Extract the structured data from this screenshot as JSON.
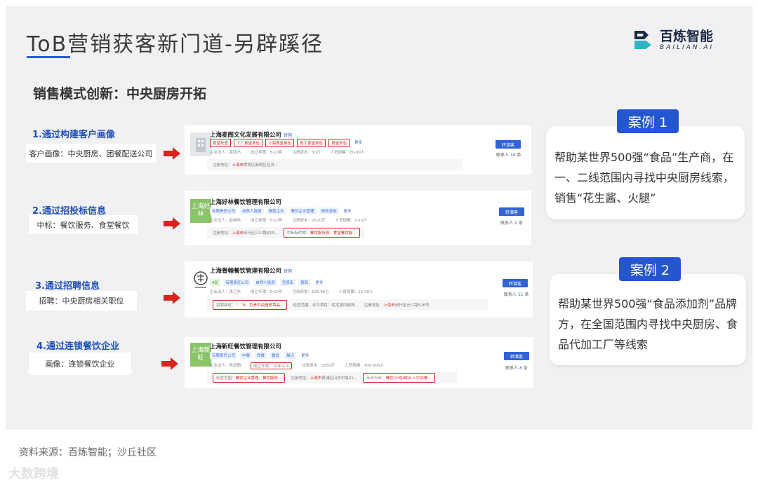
{
  "header": {
    "title": "ToB营销获客新门道-另辟蹊径",
    "subtitle": "销售模式创新：中央厨房开拓",
    "logo_main": "百炼智能",
    "logo_sub": "BAILIAN.AI"
  },
  "steps": [
    {
      "title": "1.通过构建客户画像",
      "box": "客户画像：中央厨房、团餐配送公司"
    },
    {
      "title": "2.通过招投标信息",
      "box": "中标：餐饮服务、食堂餐饮"
    },
    {
      "title": "3.通过招聘信息",
      "box": "招聘：中央厨房相关职位"
    },
    {
      "title": "4.通过连锁餐饮企业",
      "box": "画像：连锁餐饮企业"
    }
  ],
  "companies": [
    {
      "logo_text": "",
      "name": "上海麦阁文化发展有限公司",
      "badge": "官网",
      "tags": [
        "食堂托管",
        "工厂食堂承包",
        "上海食堂承包",
        "员工食堂承包",
        "食堂外包"
      ],
      "more": "更多",
      "info": [
        "企业法人：龚钧杰",
        "成立年限：5-10年",
        "注册资本：50万",
        "人员规模：20-99人"
      ],
      "addr_label": "注册地址：",
      "addr_city": "上海市",
      "addr_rest": "崇明区新明区经济...",
      "follow": "转潜客",
      "contacts_prefix": "联系人",
      "contacts_num": "10",
      "contacts_unit": "条"
    },
    {
      "logo_text": "上海好林",
      "name": "上海好林餐饮管理有限公司",
      "badge": "",
      "tags": [
        "有限责任公司",
        "自然人投资",
        "微型企业",
        "餐饮企业管理",
        "商务咨询"
      ],
      "more": "更多",
      "info": [
        "企业法人：赵继伟",
        "成立年限：5-10年",
        "注册资本：2500万",
        "人员规模：0-10人"
      ],
      "addr_label": "注册地址：",
      "addr_city": "上海市",
      "addr_rest": "闵行区江川路633...",
      "extra_label": "中标标的物：",
      "extra_value": "餐饮服务费、食堂餐饮服...",
      "follow": "转潜客",
      "contacts_prefix": "联系人",
      "contacts_num": "2",
      "contacts_unit": "条"
    },
    {
      "logo_text": "",
      "name": "上海眷翰餐饮管理有限公司",
      "badge": "官网",
      "tags": [
        "A轮",
        "有限责任公司",
        "自然人投资",
        "豆浆店",
        "银耳",
        "更多"
      ],
      "more": "",
      "info": [
        "企业法人：孫卫东",
        "成立年限：5-10年",
        "注册资本：105.96万",
        "人员规模：15-50人"
      ],
      "addr_label": "招聘描述：",
      "addr_city": "",
      "addr_rest": "\"、\"9、负责中央厨房菜品...",
      "extra_label": "经营范围：",
      "extra_value": "许可项目：住宅室内装饰...",
      "addr2_label": "注册地址：",
      "addr2_city": "上海市",
      "addr2_rest": "闵行区元江路526号",
      "follow": "转潜客",
      "contacts_prefix": "联系人",
      "contacts_num": "11",
      "contacts_unit": "条"
    },
    {
      "logo_text": "上海新旺",
      "name": "上海新旺餐饮管理有限公司",
      "badge": "",
      "tags": [
        "有限责任公司",
        "中餐",
        "西餐",
        "餐饮",
        "甜点",
        "更多"
      ],
      "more": "",
      "info": [
        "企业法人：陈卓朝",
        "成立年限：15年以上",
        "注册资本：3250万",
        "人员规模：300-500人"
      ],
      "addr_label": "经营范围：",
      "addr_city": "",
      "addr_rest": "餐饮企业管理，餐饮服务...",
      "extra_label": "注册地址：",
      "extra_city": "上海市",
      "extra_value": "黄浦区山东中路31...",
      "addr2_label": "专业行业：",
      "addr2_city": "",
      "addr2_rest": "餐饮/小吃/甜点->中式餐...",
      "follow": "转潜客",
      "contacts_prefix": "联系人",
      "contacts_num": "8",
      "contacts_unit": "条"
    }
  ],
  "cases": [
    {
      "label": "案例 1",
      "text": "帮助某世界500强“食品”生产商，在一、二线范围内寻找中央厨房线索，销售“花生酱、火腿”"
    },
    {
      "label": "案例 2",
      "text": "帮助某世界500强“食品添加剂”品牌方，在全国范围内寻找中央厨房、食品代加工厂等线索"
    }
  ],
  "footer": {
    "source": "资料来源：百炼智能；沙丘社区",
    "watermark": "大数跨境"
  },
  "colors": {
    "accent": "#2456d0",
    "highlight": "#d9241c",
    "step_title": "#1f4fb8"
  }
}
